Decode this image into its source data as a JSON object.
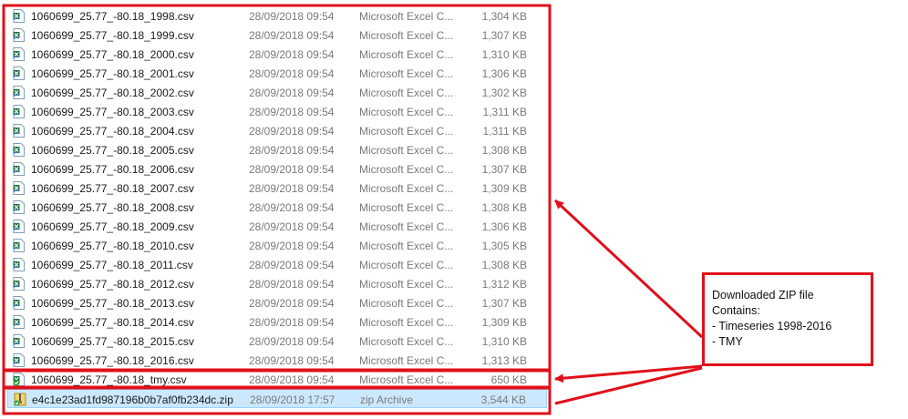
{
  "files": [
    {
      "name": "1060699_25.77_-80.18_1998.csv",
      "date": "28/09/2018 09:54",
      "type": "Microsoft Excel C...",
      "size": "1,304 KB",
      "icon": "excel-csv-icon"
    },
    {
      "name": "1060699_25.77_-80.18_1999.csv",
      "date": "28/09/2018 09:54",
      "type": "Microsoft Excel C...",
      "size": "1,307 KB",
      "icon": "excel-csv-icon"
    },
    {
      "name": "1060699_25.77_-80.18_2000.csv",
      "date": "28/09/2018 09:54",
      "type": "Microsoft Excel C...",
      "size": "1,310 KB",
      "icon": "excel-csv-icon"
    },
    {
      "name": "1060699_25.77_-80.18_2001.csv",
      "date": "28/09/2018 09:54",
      "type": "Microsoft Excel C...",
      "size": "1,306 KB",
      "icon": "excel-csv-icon"
    },
    {
      "name": "1060699_25.77_-80.18_2002.csv",
      "date": "28/09/2018 09:54",
      "type": "Microsoft Excel C...",
      "size": "1,302 KB",
      "icon": "excel-csv-icon"
    },
    {
      "name": "1060699_25.77_-80.18_2003.csv",
      "date": "28/09/2018 09:54",
      "type": "Microsoft Excel C...",
      "size": "1,311 KB",
      "icon": "excel-csv-icon"
    },
    {
      "name": "1060699_25.77_-80.18_2004.csv",
      "date": "28/09/2018 09:54",
      "type": "Microsoft Excel C...",
      "size": "1,311 KB",
      "icon": "excel-csv-icon"
    },
    {
      "name": "1060699_25.77_-80.18_2005.csv",
      "date": "28/09/2018 09:54",
      "type": "Microsoft Excel C...",
      "size": "1,308 KB",
      "icon": "excel-csv-icon"
    },
    {
      "name": "1060699_25.77_-80.18_2006.csv",
      "date": "28/09/2018 09:54",
      "type": "Microsoft Excel C...",
      "size": "1,307 KB",
      "icon": "excel-csv-icon"
    },
    {
      "name": "1060699_25.77_-80.18_2007.csv",
      "date": "28/09/2018 09:54",
      "type": "Microsoft Excel C...",
      "size": "1,309 KB",
      "icon": "excel-csv-icon"
    },
    {
      "name": "1060699_25.77_-80.18_2008.csv",
      "date": "28/09/2018 09:54",
      "type": "Microsoft Excel C...",
      "size": "1,308 KB",
      "icon": "excel-csv-icon"
    },
    {
      "name": "1060699_25.77_-80.18_2009.csv",
      "date": "28/09/2018 09:54",
      "type": "Microsoft Excel C...",
      "size": "1,306 KB",
      "icon": "excel-csv-icon"
    },
    {
      "name": "1060699_25.77_-80.18_2010.csv",
      "date": "28/09/2018 09:54",
      "type": "Microsoft Excel C...",
      "size": "1,305 KB",
      "icon": "excel-csv-icon"
    },
    {
      "name": "1060699_25.77_-80.18_2011.csv",
      "date": "28/09/2018 09:54",
      "type": "Microsoft Excel C...",
      "size": "1,308 KB",
      "icon": "excel-csv-icon"
    },
    {
      "name": "1060699_25.77_-80.18_2012.csv",
      "date": "28/09/2018 09:54",
      "type": "Microsoft Excel C...",
      "size": "1,312 KB",
      "icon": "excel-csv-icon"
    },
    {
      "name": "1060699_25.77_-80.18_2013.csv",
      "date": "28/09/2018 09:54",
      "type": "Microsoft Excel C...",
      "size": "1,307 KB",
      "icon": "excel-csv-icon"
    },
    {
      "name": "1060699_25.77_-80.18_2014.csv",
      "date": "28/09/2018 09:54",
      "type": "Microsoft Excel C...",
      "size": "1,309 KB",
      "icon": "excel-csv-icon"
    },
    {
      "name": "1060699_25.77_-80.18_2015.csv",
      "date": "28/09/2018 09:54",
      "type": "Microsoft Excel C...",
      "size": "1,310 KB",
      "icon": "excel-csv-icon"
    },
    {
      "name": "1060699_25.77_-80.18_2016.csv",
      "date": "28/09/2018 09:54",
      "type": "Microsoft Excel C...",
      "size": "1,313 KB",
      "icon": "excel-csv-icon"
    },
    {
      "name": "1060699_25.77_-80.18_tmy.csv",
      "date": "28/09/2018 09:54",
      "type": "Microsoft Excel C...",
      "size": "650 KB",
      "icon": "excel-csv-synced-icon"
    },
    {
      "name": "e4c1e23ad1fd987196b0b7af0fb234dc.zip",
      "date": "28/09/2018 17:57",
      "type": "zip Archive",
      "size": "3,544 KB",
      "icon": "zip-archive-icon",
      "selected": true
    }
  ],
  "callout": {
    "lines": [
      "Downloaded ZIP file",
      "Contains:",
      "- Timeseries 1998-2016",
      "- TMY"
    ]
  },
  "colors": {
    "annotation_red": "#e0101a",
    "selection_bg": "#cce8ff",
    "excel_green": "#1e7145"
  }
}
